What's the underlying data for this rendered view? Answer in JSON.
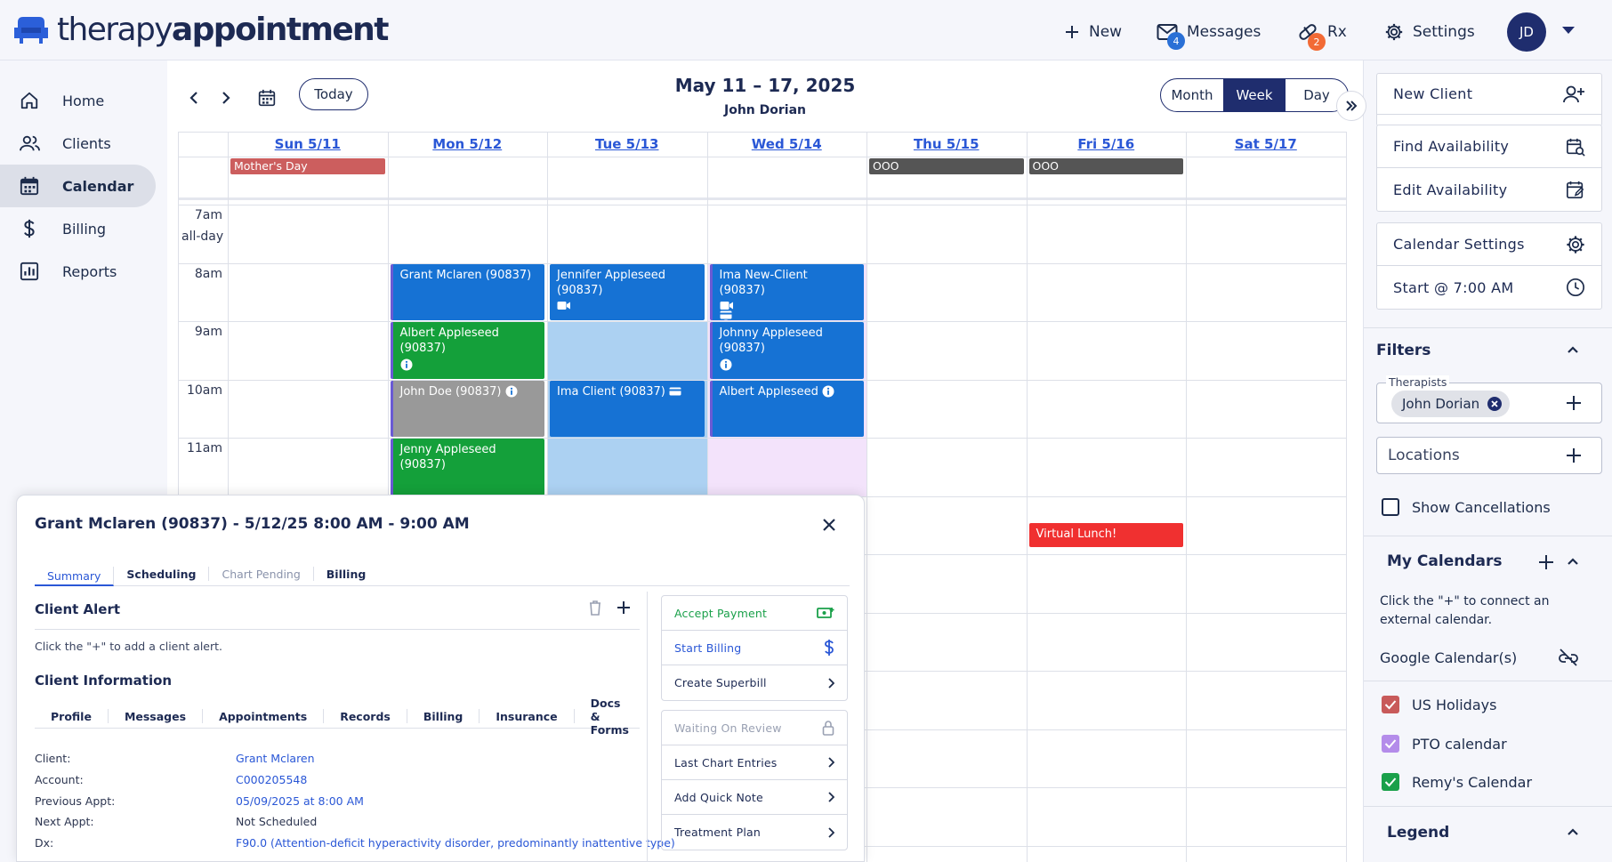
{
  "header": {
    "logo_light": "therapy",
    "logo_bold": "appointment",
    "new_label": "New",
    "messages_label": "Messages",
    "messages_badge": "4",
    "rx_label": "Rx",
    "rx_badge": "2",
    "settings_label": "Settings",
    "avatar_initials": "JD"
  },
  "sidebar": {
    "items": [
      {
        "label": "Home",
        "icon": "home-icon"
      },
      {
        "label": "Clients",
        "icon": "clients-icon"
      },
      {
        "label": "Calendar",
        "icon": "calendar-icon",
        "active": true
      },
      {
        "label": "Billing",
        "icon": "dollar-icon"
      },
      {
        "label": "Reports",
        "icon": "reports-icon"
      }
    ]
  },
  "calendar": {
    "today_label": "Today",
    "range": "May 11 – 17, 2025",
    "therapist": "John Dorian",
    "views": [
      "Month",
      "Week",
      "Day"
    ],
    "active_view": "Week",
    "days": [
      "Sun 5/11",
      "Mon 5/12",
      "Tue 5/13",
      "Wed 5/14",
      "Thu 5/15",
      "Fri 5/16",
      "Sat 5/17"
    ],
    "allday_label": "all-day",
    "hours": [
      "7am",
      "8am",
      "9am",
      "10am",
      "11am"
    ],
    "allday_events": [
      {
        "day": 0,
        "title": "Mother's Day",
        "color": "#cc5e5e"
      },
      {
        "day": 4,
        "title": "OOO",
        "color": "#555555"
      },
      {
        "day": 5,
        "title": "OOO",
        "color": "#555555"
      }
    ],
    "events": [
      {
        "day": 1,
        "start": 8,
        "end": 9,
        "title": "Grant Mclaren (90837)",
        "color": "#1672d4"
      },
      {
        "day": 1,
        "start": 9,
        "end": 10,
        "title": "Albert Appleseed (90837)",
        "color": "#14a03a"
      },
      {
        "day": 1,
        "start": 10,
        "end": 11,
        "title": "John Doe (90837)",
        "color": "#999999"
      },
      {
        "day": 1,
        "start": 11,
        "end": 12,
        "title": "Jenny Appleseed (90837)",
        "color": "#14a03a"
      },
      {
        "day": 2,
        "start": 8,
        "end": 9,
        "title": "Jennifer Appleseed (90837)",
        "color": "#1672d4"
      },
      {
        "day": 2,
        "start": 10,
        "end": 11,
        "title": "Ima Client (90837)",
        "color": "#1672d4"
      },
      {
        "day": 3,
        "start": 8,
        "end": 9,
        "title": "Ima New-Client (90837)",
        "color": "#1672d4"
      },
      {
        "day": 3,
        "start": 9,
        "end": 10,
        "title": "Johnny Appleseed (90837)",
        "color": "#1672d4"
      },
      {
        "day": 3,
        "start": 10,
        "end": 11,
        "title": "Albert Appleseed",
        "color": "#1672d4"
      },
      {
        "day": 5,
        "start": 12.45,
        "end": 12.9,
        "title": "Virtual Lunch!",
        "color": "#f03030"
      }
    ]
  },
  "popup": {
    "title": "Grant Mclaren (90837) - 5/12/25 8:00 AM - 9:00 AM",
    "tabs": [
      "Summary",
      "Scheduling",
      "Chart Pending",
      "Billing"
    ],
    "alert_title": "Client Alert",
    "alert_note": "Click the \"+\" to add a client alert.",
    "info_title": "Client Information",
    "info_tabs": [
      "Profile",
      "Messages",
      "Appointments",
      "Records",
      "Billing",
      "Insurance",
      "Docs & Forms"
    ],
    "fields": [
      {
        "k": "Client:",
        "v": "Grant Mclaren",
        "link": true
      },
      {
        "k": "Account:",
        "v": "C000205548",
        "link": true
      },
      {
        "k": "Previous Appt:",
        "v": "05/09/2025 at 8:00 AM",
        "link": true
      },
      {
        "k": "Next Appt:",
        "v": "Not Scheduled",
        "link": false
      },
      {
        "k": "Dx:",
        "v": "F90.0 (Attention-deficit hyperactivity disorder, predominantly inattentive type)",
        "link": true
      }
    ],
    "actions_group1": [
      "Accept Payment",
      "Start Billing",
      "Create Superbill"
    ],
    "actions_group2": [
      "Waiting On Review",
      "Last Chart Entries",
      "Add Quick Note",
      "Treatment Plan"
    ]
  },
  "right_panel": {
    "group1": [
      "New Client",
      "Find Availability",
      "Edit Availability"
    ],
    "group2": [
      "Calendar Settings",
      "Start @ 7:00 AM"
    ],
    "filters_title": "Filters",
    "therapists_label": "Therapists",
    "therapist_chip": "John Dorian",
    "locations_label": "Locations",
    "show_cancellations": "Show Cancellations",
    "my_calendars_title": "My Calendars",
    "connect_note": "Click the \"+\" to connect an external calendar.",
    "google_label": "Google Calendar(s)",
    "calendars": [
      {
        "label": "US Holidays",
        "color": "#c85a5a"
      },
      {
        "label": "PTO calendar",
        "color": "#b48cea"
      },
      {
        "label": "Remy's Calendar",
        "color": "#1aa04a"
      }
    ],
    "legend_title": "Legend"
  }
}
